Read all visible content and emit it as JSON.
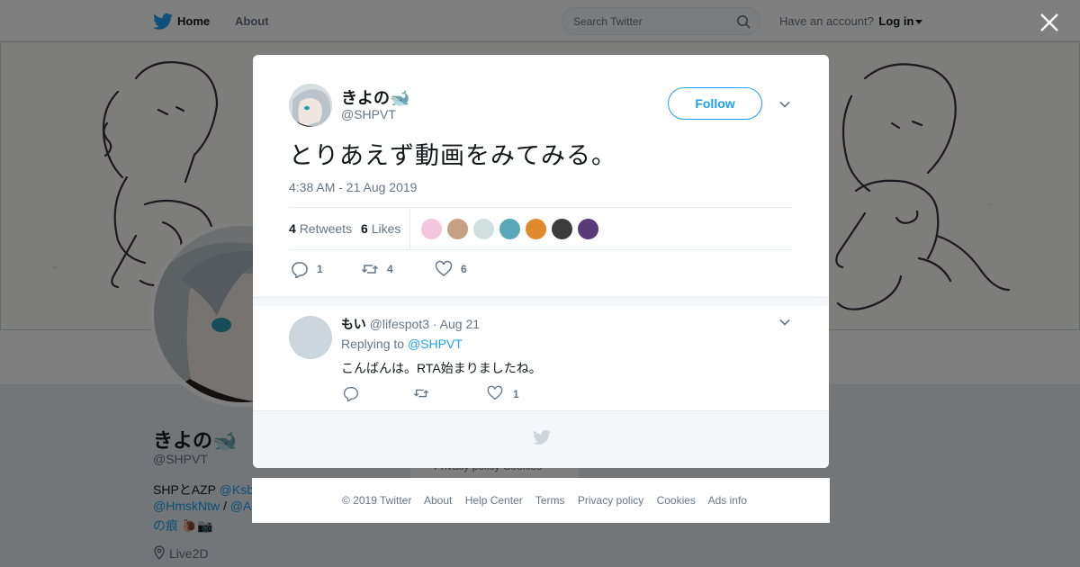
{
  "nav": {
    "home": "Home",
    "about": "About",
    "search_placeholder": "Search Twitter",
    "have_account": "Have an account?",
    "login": "Log in"
  },
  "profile": {
    "name": "きよの🐋",
    "handle": "@SHPVT",
    "bio_prefix": "SHPとAZP",
    "bio_link1": "@Ksb",
    "bio_link2": "@HmskNtw",
    "bio_sep": " / ",
    "bio_link3": "@A",
    "bio_line3": "の痕 🐌📷",
    "location": "Live2D",
    "bg_footer": "Privacy policy  Cookies"
  },
  "tweet": {
    "author_name": "きよの🐋",
    "author_handle": "@SHPVT",
    "follow_label": "Follow",
    "text": "とりあえず動画をみてみる。",
    "timestamp": "4:38 AM - 21 Aug 2019",
    "retweets_count": "4",
    "retweets_label": "Retweets",
    "likes_count": "6",
    "likes_label": "Likes",
    "likers": [
      {
        "color": "#f3c6dd"
      },
      {
        "color": "#c7a083"
      },
      {
        "color": "#cfe0df"
      },
      {
        "color": "#5aa7b8"
      },
      {
        "color": "#e08a2b"
      },
      {
        "color": "#3b3b3b"
      },
      {
        "color": "#5b3a7a"
      }
    ],
    "reply_count": "1",
    "retweet_count": "4",
    "like_count": "6"
  },
  "reply": {
    "name": "もい",
    "handle": "@lifespot3",
    "date": "· Aug 21",
    "replying_label": "Replying to",
    "replying_to": "@SHPVT",
    "text": "こんばんは。RTA始まりましたね。",
    "like_count": "1"
  },
  "footer": {
    "copyright": "© 2019 Twitter",
    "about": "About",
    "help": "Help Center",
    "terms": "Terms",
    "privacy": "Privacy policy",
    "cookies": "Cookies",
    "ads": "Ads info"
  },
  "colors": {
    "brand": "#1da1f2",
    "muted": "#657786"
  }
}
